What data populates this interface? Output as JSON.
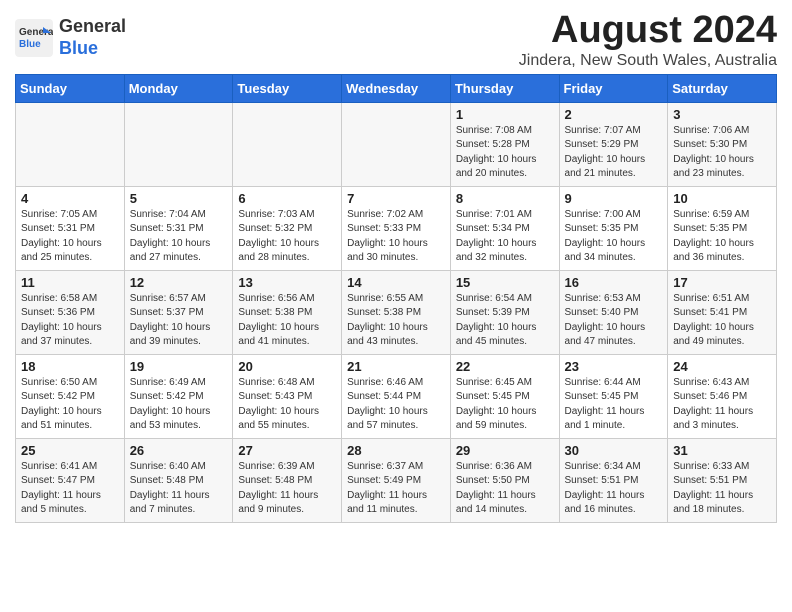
{
  "logo": {
    "general": "General",
    "blue": "Blue"
  },
  "title": "August 2024",
  "subtitle": "Jindera, New South Wales, Australia",
  "days_of_week": [
    "Sunday",
    "Monday",
    "Tuesday",
    "Wednesday",
    "Thursday",
    "Friday",
    "Saturday"
  ],
  "weeks": [
    [
      {
        "day": "",
        "info": ""
      },
      {
        "day": "",
        "info": ""
      },
      {
        "day": "",
        "info": ""
      },
      {
        "day": "",
        "info": ""
      },
      {
        "day": "1",
        "info": "Sunrise: 7:08 AM\nSunset: 5:28 PM\nDaylight: 10 hours\nand 20 minutes."
      },
      {
        "day": "2",
        "info": "Sunrise: 7:07 AM\nSunset: 5:29 PM\nDaylight: 10 hours\nand 21 minutes."
      },
      {
        "day": "3",
        "info": "Sunrise: 7:06 AM\nSunset: 5:30 PM\nDaylight: 10 hours\nand 23 minutes."
      }
    ],
    [
      {
        "day": "4",
        "info": "Sunrise: 7:05 AM\nSunset: 5:31 PM\nDaylight: 10 hours\nand 25 minutes."
      },
      {
        "day": "5",
        "info": "Sunrise: 7:04 AM\nSunset: 5:31 PM\nDaylight: 10 hours\nand 27 minutes."
      },
      {
        "day": "6",
        "info": "Sunrise: 7:03 AM\nSunset: 5:32 PM\nDaylight: 10 hours\nand 28 minutes."
      },
      {
        "day": "7",
        "info": "Sunrise: 7:02 AM\nSunset: 5:33 PM\nDaylight: 10 hours\nand 30 minutes."
      },
      {
        "day": "8",
        "info": "Sunrise: 7:01 AM\nSunset: 5:34 PM\nDaylight: 10 hours\nand 32 minutes."
      },
      {
        "day": "9",
        "info": "Sunrise: 7:00 AM\nSunset: 5:35 PM\nDaylight: 10 hours\nand 34 minutes."
      },
      {
        "day": "10",
        "info": "Sunrise: 6:59 AM\nSunset: 5:35 PM\nDaylight: 10 hours\nand 36 minutes."
      }
    ],
    [
      {
        "day": "11",
        "info": "Sunrise: 6:58 AM\nSunset: 5:36 PM\nDaylight: 10 hours\nand 37 minutes."
      },
      {
        "day": "12",
        "info": "Sunrise: 6:57 AM\nSunset: 5:37 PM\nDaylight: 10 hours\nand 39 minutes."
      },
      {
        "day": "13",
        "info": "Sunrise: 6:56 AM\nSunset: 5:38 PM\nDaylight: 10 hours\nand 41 minutes."
      },
      {
        "day": "14",
        "info": "Sunrise: 6:55 AM\nSunset: 5:38 PM\nDaylight: 10 hours\nand 43 minutes."
      },
      {
        "day": "15",
        "info": "Sunrise: 6:54 AM\nSunset: 5:39 PM\nDaylight: 10 hours\nand 45 minutes."
      },
      {
        "day": "16",
        "info": "Sunrise: 6:53 AM\nSunset: 5:40 PM\nDaylight: 10 hours\nand 47 minutes."
      },
      {
        "day": "17",
        "info": "Sunrise: 6:51 AM\nSunset: 5:41 PM\nDaylight: 10 hours\nand 49 minutes."
      }
    ],
    [
      {
        "day": "18",
        "info": "Sunrise: 6:50 AM\nSunset: 5:42 PM\nDaylight: 10 hours\nand 51 minutes."
      },
      {
        "day": "19",
        "info": "Sunrise: 6:49 AM\nSunset: 5:42 PM\nDaylight: 10 hours\nand 53 minutes."
      },
      {
        "day": "20",
        "info": "Sunrise: 6:48 AM\nSunset: 5:43 PM\nDaylight: 10 hours\nand 55 minutes."
      },
      {
        "day": "21",
        "info": "Sunrise: 6:46 AM\nSunset: 5:44 PM\nDaylight: 10 hours\nand 57 minutes."
      },
      {
        "day": "22",
        "info": "Sunrise: 6:45 AM\nSunset: 5:45 PM\nDaylight: 10 hours\nand 59 minutes."
      },
      {
        "day": "23",
        "info": "Sunrise: 6:44 AM\nSunset: 5:45 PM\nDaylight: 11 hours\nand 1 minute."
      },
      {
        "day": "24",
        "info": "Sunrise: 6:43 AM\nSunset: 5:46 PM\nDaylight: 11 hours\nand 3 minutes."
      }
    ],
    [
      {
        "day": "25",
        "info": "Sunrise: 6:41 AM\nSunset: 5:47 PM\nDaylight: 11 hours\nand 5 minutes."
      },
      {
        "day": "26",
        "info": "Sunrise: 6:40 AM\nSunset: 5:48 PM\nDaylight: 11 hours\nand 7 minutes."
      },
      {
        "day": "27",
        "info": "Sunrise: 6:39 AM\nSunset: 5:48 PM\nDaylight: 11 hours\nand 9 minutes."
      },
      {
        "day": "28",
        "info": "Sunrise: 6:37 AM\nSunset: 5:49 PM\nDaylight: 11 hours\nand 11 minutes."
      },
      {
        "day": "29",
        "info": "Sunrise: 6:36 AM\nSunset: 5:50 PM\nDaylight: 11 hours\nand 14 minutes."
      },
      {
        "day": "30",
        "info": "Sunrise: 6:34 AM\nSunset: 5:51 PM\nDaylight: 11 hours\nand 16 minutes."
      },
      {
        "day": "31",
        "info": "Sunrise: 6:33 AM\nSunset: 5:51 PM\nDaylight: 11 hours\nand 18 minutes."
      }
    ]
  ]
}
